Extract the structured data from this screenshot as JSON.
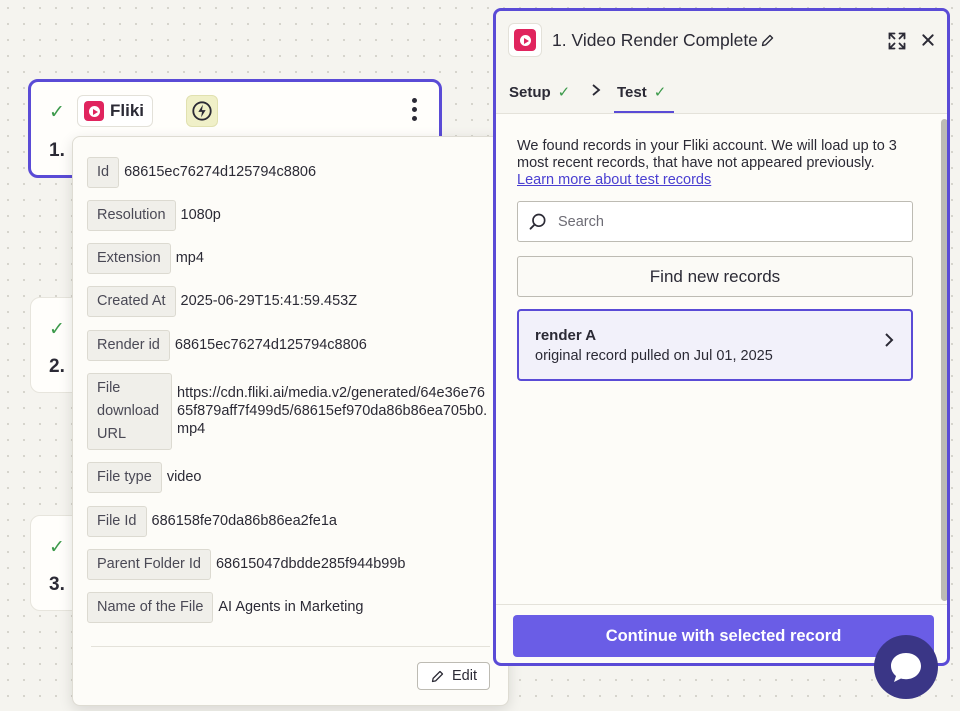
{
  "canvas": {
    "step1": {
      "app_name": "Fliki",
      "number": "1."
    },
    "step2": {
      "number": "2."
    },
    "step3": {
      "number": "3."
    }
  },
  "popup": {
    "fields": [
      {
        "key": "Id",
        "value": "68615ec76274d125794c8806"
      },
      {
        "key": "Resolution",
        "value": "1080p"
      },
      {
        "key": "Extension",
        "value": "mp4"
      },
      {
        "key": "Created At",
        "value": "2025-06-29T15:41:59.453Z"
      },
      {
        "key": "Render id",
        "value": "68615ec76274d125794c8806"
      },
      {
        "key": "File download URL",
        "value": "https://cdn.fliki.ai/media.v2/generated/64e36e7665f879aff7f499d5/68615ef970da86b86ea705b0.mp4"
      },
      {
        "key": "File type",
        "value": "video"
      },
      {
        "key": "File Id",
        "value": "686158fe70da86b86ea2fe1a"
      },
      {
        "key": "Parent Folder Id",
        "value": "68615047dbdde285f944b99b"
      },
      {
        "key": "Name of the File",
        "value": "AI Agents in Marketing"
      }
    ],
    "edit_label": "Edit"
  },
  "panel": {
    "title": "1.  Video Render Complete",
    "tabs": [
      {
        "label": "Setup"
      },
      {
        "label": "Test"
      }
    ],
    "intro_text": "We found records in your Fliki account. We will load up to 3 most recent records, that have not appeared previously.",
    "learn_more_link": "Learn more about test records",
    "search": {
      "placeholder": "Search"
    },
    "find_button": "Find new records",
    "record": {
      "title": "render A",
      "subtitle": "original record pulled on Jul 01, 2025"
    },
    "continue_button": "Continue with selected record"
  },
  "colors": {
    "accent": "#5a4bd6",
    "button_primary": "#6a5de6",
    "success": "#3c9a4b",
    "fliki_brand": "#e0245e",
    "chat": "#3a3686"
  },
  "icons": [
    "check-icon",
    "fliki-logo-icon",
    "bolt-icon",
    "more-vertical-icon",
    "pencil-icon",
    "expand-icon",
    "close-icon",
    "chevron-right-icon",
    "search-icon",
    "chat-icon"
  ]
}
